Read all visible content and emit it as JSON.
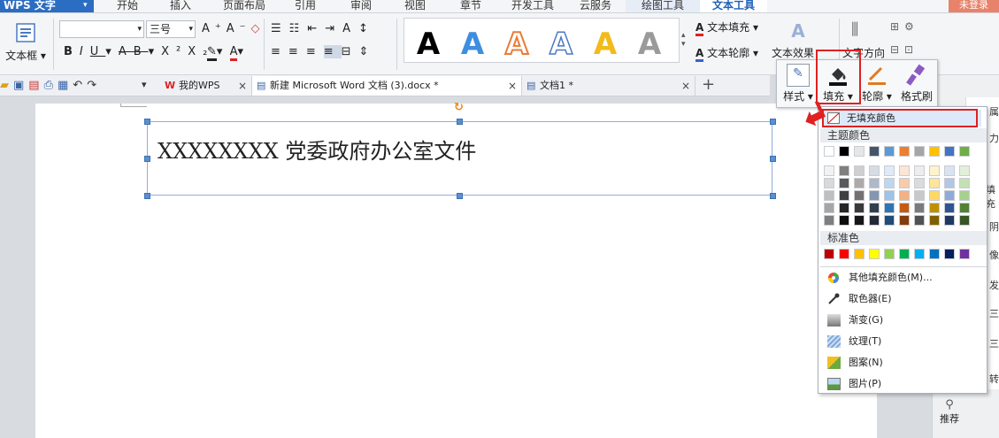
{
  "app": {
    "name": "WPS 文字",
    "login": "未登录"
  },
  "menu_tabs": [
    "开始",
    "插入",
    "页面布局",
    "引用",
    "审阅",
    "视图",
    "章节",
    "开发工具",
    "云服务",
    "绘图工具",
    "文本工具"
  ],
  "ribbon": {
    "textbox_label": "文本框",
    "font_size": "三号",
    "font_name": "",
    "wordart_letters": [
      "A",
      "A",
      "A",
      "A",
      "A",
      "A"
    ],
    "text_fill": "文本填充",
    "text_outline": "文本轮廓",
    "text_effect": "文本效果",
    "text_direction": "文字方向"
  },
  "doc_tabs": [
    {
      "label": "我的WPS"
    },
    {
      "label": "新建 Microsoft Word 文档 (3).docx *"
    },
    {
      "label": "文档1 *"
    }
  ],
  "new_tab_symbol": "+",
  "document": {
    "textbox_text": "XXXXXXXX 党委政府办公室文件"
  },
  "shape_toolbar": {
    "style": "样式",
    "fill": "填充",
    "outline": "轮廓",
    "format_painter": "格式刷"
  },
  "fill_menu": {
    "no_fill": "无填充颜色",
    "theme_colors_title": "主题颜色",
    "standard_colors_title": "标准色",
    "theme_top_row": [
      "#ffffff",
      "#000000",
      "#e7e6e6",
      "#44546a",
      "#5b9bd5",
      "#ed7d31",
      "#a5a5a5",
      "#ffc000",
      "#4472c4",
      "#70ad47"
    ],
    "theme_shades": [
      [
        "#f2f2f2",
        "#7f7f7f",
        "#d0cece",
        "#d6dce4",
        "#deebf6",
        "#fbe5d5",
        "#ededed",
        "#fff2cc",
        "#dae3f3",
        "#e2efd9"
      ],
      [
        "#d9d9d9",
        "#595959",
        "#aeaaaa",
        "#adb9ca",
        "#bdd7ee",
        "#f7cbac",
        "#dbdbdb",
        "#fee599",
        "#b4c6e7",
        "#c5e0b3"
      ],
      [
        "#bfbfbf",
        "#404040",
        "#757070",
        "#8496b0",
        "#9dc3e6",
        "#f4b183",
        "#c9c9c9",
        "#ffd965",
        "#8eaadb",
        "#a8d08d"
      ],
      [
        "#a6a6a6",
        "#262626",
        "#3a3838",
        "#323f4f",
        "#2e75b5",
        "#c55a11",
        "#7b7b7b",
        "#bf9000",
        "#2f5496",
        "#538135"
      ],
      [
        "#7f7f7f",
        "#0d0d0d",
        "#171616",
        "#222a35",
        "#1e4e79",
        "#843c0b",
        "#525252",
        "#7f6000",
        "#203864",
        "#375623"
      ]
    ],
    "standard_colors": [
      "#c00000",
      "#ff0000",
      "#ffc000",
      "#ffff00",
      "#92d050",
      "#00b050",
      "#00b0f0",
      "#0070c0",
      "#002060",
      "#7030a0"
    ],
    "items": [
      {
        "label": "其他填充颜色(M)...",
        "icon": "color-wheel-icon"
      },
      {
        "label": "取色器(E)",
        "icon": "eyedropper-icon"
      },
      {
        "label": "渐变(G)",
        "icon": "gradient-icon"
      },
      {
        "label": "纹理(T)",
        "icon": "texture-icon"
      },
      {
        "label": "图案(N)",
        "icon": "pattern-icon"
      },
      {
        "label": "图片(P)",
        "icon": "picture-icon"
      }
    ]
  },
  "right_panel": {
    "chars": [
      "属",
      "力",
      "填充",
      "阴",
      "像",
      "发",
      "三",
      "三",
      "转"
    ],
    "recommend": "推荐"
  }
}
